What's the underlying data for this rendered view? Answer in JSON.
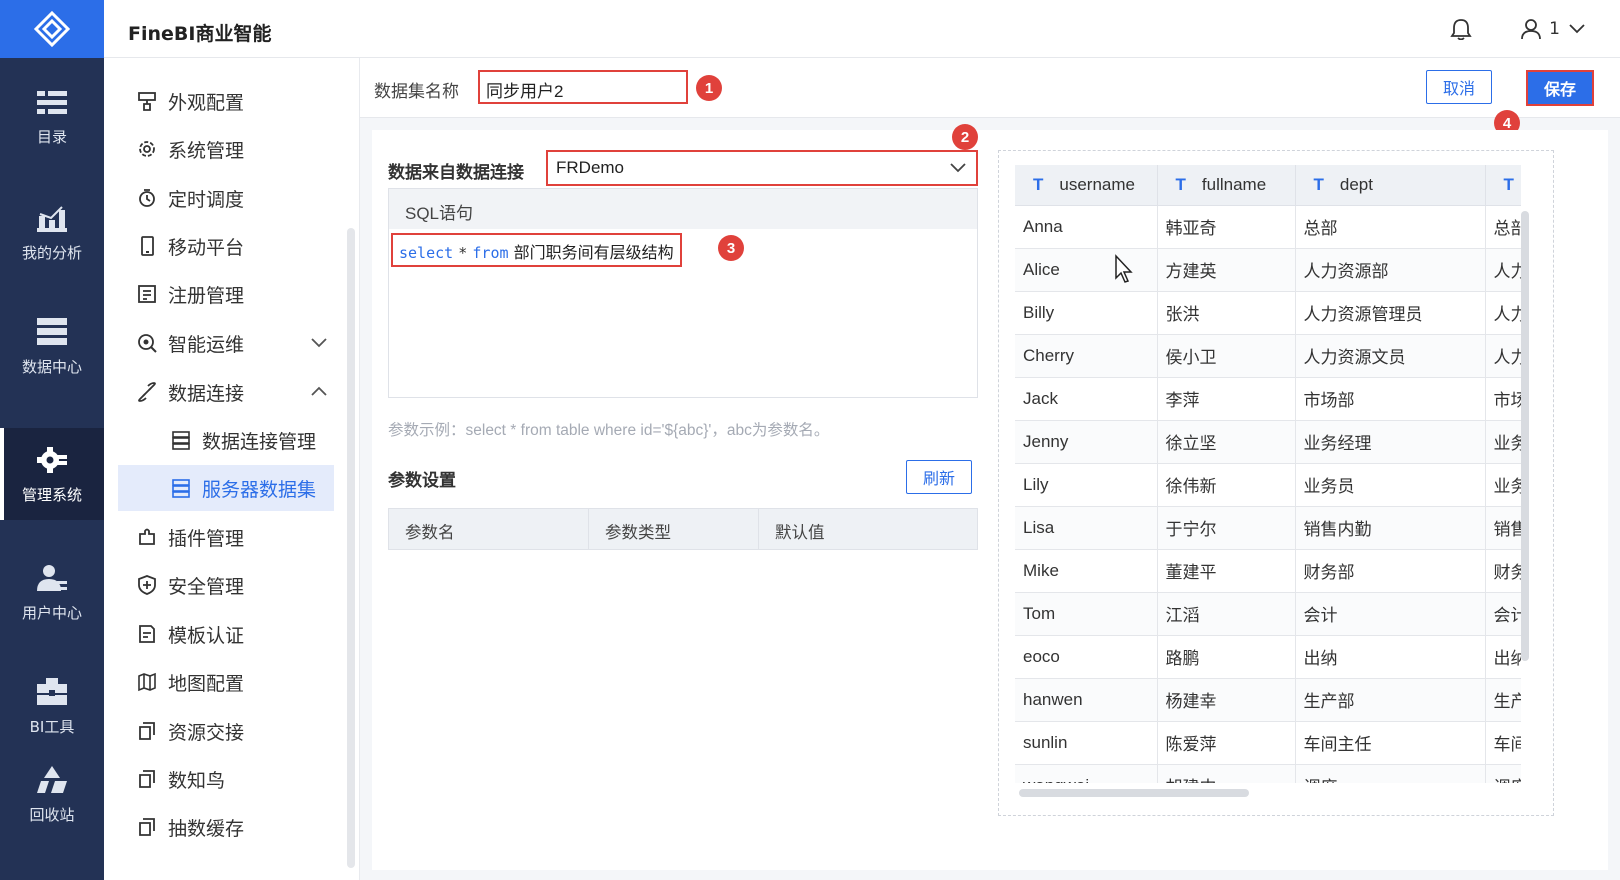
{
  "app": {
    "title": "FineBI商业智能",
    "user_count": "1"
  },
  "rail": {
    "items": [
      {
        "label": "目录",
        "icon": "catalog-icon"
      },
      {
        "label": "我的分析",
        "icon": "analysis-icon"
      },
      {
        "label": "数据中心",
        "icon": "data-center-icon"
      },
      {
        "label": "管理系统",
        "icon": "gear-icon",
        "active": true
      },
      {
        "label": "用户中心",
        "icon": "user-center-icon"
      },
      {
        "label": "BI工具",
        "icon": "toolbox-icon"
      },
      {
        "label": "回收站",
        "icon": "recycle-icon"
      }
    ]
  },
  "subnav": {
    "items": [
      {
        "label": "外观配置",
        "icon": "appearance-icon"
      },
      {
        "label": "系统管理",
        "icon": "settings-icon"
      },
      {
        "label": "定时调度",
        "icon": "timer-icon"
      },
      {
        "label": "移动平台",
        "icon": "mobile-icon"
      },
      {
        "label": "注册管理",
        "icon": "register-icon"
      },
      {
        "label": "智能运维",
        "icon": "ops-icon",
        "expand": "down"
      },
      {
        "label": "数据连接",
        "icon": "link-icon",
        "expand": "up"
      },
      {
        "label": "数据连接管理",
        "icon": "db-icon",
        "child": true
      },
      {
        "label": "服务器数据集",
        "icon": "db-icon",
        "child": true,
        "selected": true
      },
      {
        "label": "插件管理",
        "icon": "plugin-icon"
      },
      {
        "label": "安全管理",
        "icon": "shield-icon"
      },
      {
        "label": "模板认证",
        "icon": "template-icon"
      },
      {
        "label": "地图配置",
        "icon": "map-icon"
      },
      {
        "label": "资源交接",
        "icon": "copy-icon"
      },
      {
        "label": "数知鸟",
        "icon": "copy-icon"
      },
      {
        "label": "抽数缓存",
        "icon": "copy-icon"
      }
    ]
  },
  "toolbar": {
    "dataset_label": "数据集名称",
    "dataset_name": "同步用户2",
    "cancel_label": "取消",
    "save_label": "保存"
  },
  "markers": [
    "1",
    "2",
    "3",
    "4"
  ],
  "form": {
    "connection_label": "数据来自数据连接",
    "connection_value": "FRDemo",
    "sql_header": "SQL语句",
    "sql_select": "select",
    "sql_star": "*",
    "sql_from": "from",
    "sql_table": "部门职务间有层级结构",
    "hint": "参数示例：select * from table where id='${abc}'，abc为参数名。",
    "params_title": "参数设置",
    "refresh_label": "刷新",
    "param_columns": [
      "参数名",
      "参数类型",
      "默认值"
    ]
  },
  "preview": {
    "type_glyph": "T",
    "columns": [
      "username",
      "fullname",
      "dept",
      ""
    ],
    "rows": [
      [
        "Anna",
        "韩亚奇",
        "总部",
        "总部"
      ],
      [
        "Alice",
        "方建英",
        "人力资源部",
        "人力"
      ],
      [
        "Billy",
        "张洪",
        "人力资源管理员",
        "人力"
      ],
      [
        "Cherry",
        "侯小卫",
        "人力资源文员",
        "人力"
      ],
      [
        "Jack",
        "李萍",
        "市场部",
        "市场"
      ],
      [
        "Jenny",
        "徐立坚",
        "业务经理",
        "业务"
      ],
      [
        "Lily",
        "徐伟新",
        "业务员",
        "业务"
      ],
      [
        "Lisa",
        "于宁尔",
        "销售内勤",
        "销售"
      ],
      [
        "Mike",
        "董建平",
        "财务部",
        "财务"
      ],
      [
        "Tom",
        "江滔",
        "会计",
        "会计"
      ],
      [
        "eoco",
        "路鹏",
        "出纳",
        "出纳"
      ],
      [
        "hanwen",
        "杨建幸",
        "生产部",
        "生产"
      ],
      [
        "sunlin",
        "陈爱萍",
        "车间主任",
        "车间"
      ],
      [
        "wangwei",
        "胡建中",
        "调度",
        "调度"
      ]
    ]
  }
}
